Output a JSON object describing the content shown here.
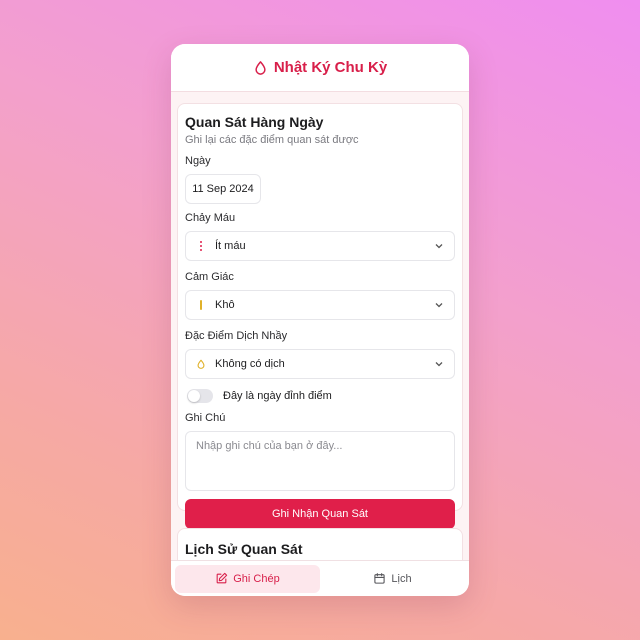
{
  "header": {
    "title": "Nhật Ký Chu Kỳ",
    "icon": "drop-icon",
    "accent": "#d81f4a"
  },
  "form": {
    "title": "Quan Sát Hàng Ngày",
    "subtitle": "Ghi lại các đặc điểm quan sát được",
    "date_label": "Ngày",
    "date_value": "11 Sep 2024",
    "bleeding_label": "Chảy Máu",
    "bleeding_value": "Ít máu",
    "sensation_label": "Cảm Giác",
    "sensation_value": "Khô",
    "mucus_label": "Đặc Điểm Dịch Nhầy",
    "mucus_value": "Không có dịch",
    "peak_label": "Đây là ngày đỉnh điểm",
    "peak_on": false,
    "notes_label": "Ghi Chú",
    "notes_placeholder": "Nhập ghi chú của bạn ở đây...",
    "submit_label": "Ghi Nhận Quan Sát",
    "submit_color": "#e01f4a"
  },
  "history": {
    "title": "Lịch Sử Quan Sát"
  },
  "tabs": [
    {
      "label": "Ghi Chép",
      "icon": "edit-icon",
      "active": true
    },
    {
      "label": "Lịch",
      "icon": "calendar-icon",
      "active": false
    }
  ]
}
